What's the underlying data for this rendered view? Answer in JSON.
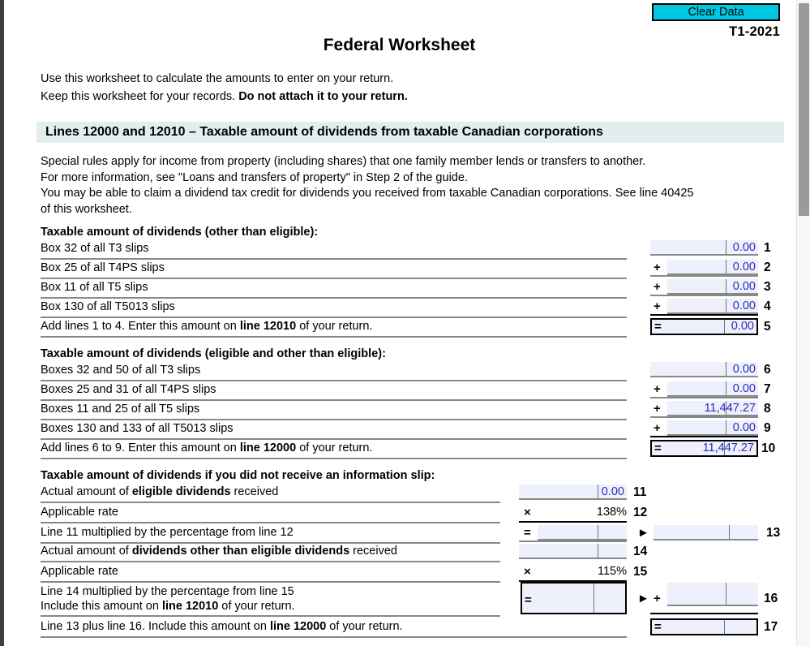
{
  "toolbar": {
    "clear_data_label": "Clear Data",
    "form_year": "T1-2021"
  },
  "header": {
    "title": "Federal Worksheet",
    "intro_line1": "Use this worksheet to calculate the amounts to enter on your return.",
    "intro_line2_plain": "Keep this worksheet for your records. ",
    "intro_line2_bold": "Do not attach it to your return."
  },
  "section": {
    "heading": "Lines 12000 and 12010 – Taxable amount of dividends from taxable Canadian corporations",
    "para1_line1": "Special rules apply for income from property (including shares) that one family member lends or transfers to another.",
    "para1_line2": "For more information, see \"Loans and transfers of property\" in Step 2 of the guide.",
    "para2_line1": "You may be able to claim a dividend tax credit for dividends you received from taxable Canadian corporations. See line 40425",
    "para2_line2": "of this worksheet."
  },
  "group1": {
    "title": "Taxable amount of dividends (other than eligible):",
    "rows": [
      {
        "label": "Box 32 of all T3 slips",
        "op": "",
        "value": "0.00",
        "lineno": "1"
      },
      {
        "label": "Box 25 of all T4PS slips",
        "op": "+",
        "value": "0.00",
        "lineno": "2"
      },
      {
        "label": "Box 11 of all T5 slips",
        "op": "+",
        "value": "0.00",
        "lineno": "3"
      },
      {
        "label": "Box 130 of all T5013 slips",
        "op": "+",
        "value": "0.00",
        "lineno": "4"
      },
      {
        "label_pre": "Add lines 1 to 4. Enter this amount on ",
        "label_bold": "line 12010",
        "label_post": " of your return.",
        "op": "=",
        "value": "0.00",
        "lineno": "5"
      }
    ]
  },
  "group2": {
    "title": "Taxable amount of dividends (eligible and other than eligible):",
    "rows": [
      {
        "label": "Boxes 32 and 50 of all T3 slips",
        "op": "",
        "value": "0.00",
        "lineno": "6"
      },
      {
        "label": "Boxes 25 and 31 of all T4PS slips",
        "op": "+",
        "value": "0.00",
        "lineno": "7"
      },
      {
        "label": "Boxes 11 and 25 of all T5 slips",
        "op": "+",
        "value": "11,447.27",
        "lineno": "8"
      },
      {
        "label": "Boxes 130 and 133 of all T5013 slips",
        "op": "+",
        "value": "0.00",
        "lineno": "9"
      },
      {
        "label_pre": "Add lines 6 to 9. Enter this amount on ",
        "label_bold": "line 12000",
        "label_post": " of your return.",
        "op": "=",
        "value": "11,447.27",
        "lineno": "10"
      }
    ]
  },
  "group3": {
    "title": "Taxable amount of dividends if you did not receive an information slip:",
    "row11": {
      "label_pre": "Actual amount of ",
      "label_bold": "eligible dividends",
      "label_post": " received",
      "value": "0.00",
      "lineno": "11"
    },
    "row12": {
      "label": "Applicable rate",
      "op": "×",
      "value": "138%",
      "lineno": "12"
    },
    "row13": {
      "label": "Line 11 multiplied by the percentage from line 12",
      "op": "=",
      "arrow": "►",
      "value": "",
      "lineno": "13"
    },
    "row14": {
      "label_pre": "Actual amount of ",
      "label_bold": "dividends other than eligible dividends",
      "label_post": " received",
      "value": "",
      "lineno": "14"
    },
    "row15": {
      "label": "Applicable rate",
      "op": "×",
      "value": "115%",
      "lineno": "15"
    },
    "row16": {
      "label_line1": "Line 14 multiplied by the percentage from line 15",
      "label_pre2": "Include this amount on ",
      "label_bold2": "line 12010",
      "label_post2": " of your return.",
      "op": "=",
      "arrow": "►",
      "op2": "+",
      "value": "",
      "lineno": "16"
    },
    "row17": {
      "label_pre": "Line 13 plus line 16. Include this amount on ",
      "label_bold": "line 12000",
      "label_post": " of your return.",
      "op": "=",
      "value": "",
      "lineno": "17"
    }
  },
  "colors": {
    "accent_button": "#00c8e0",
    "section_header_bg": "#e2edee",
    "field_bg": "#eef0fb",
    "field_text": "#2b2bbb"
  }
}
